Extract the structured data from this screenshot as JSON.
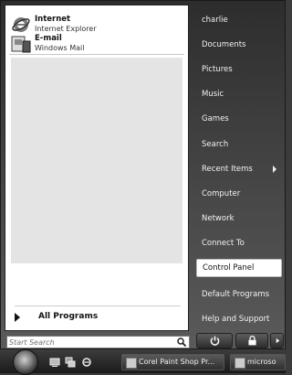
{
  "pinned": [
    {
      "title": "Internet",
      "subtitle": "Internet Explorer",
      "icon": "internet-explorer-icon"
    },
    {
      "title": "E-mail",
      "subtitle": "Windows Mail",
      "icon": "windows-mail-icon"
    }
  ],
  "all_programs": {
    "label": "All Programs"
  },
  "search": {
    "placeholder": "Start Search"
  },
  "right_pane": {
    "items": [
      {
        "label": "charlie"
      },
      {
        "label": "Documents"
      },
      {
        "label": "Pictures"
      },
      {
        "label": "Music"
      },
      {
        "label": "Games"
      },
      {
        "label": "Search"
      },
      {
        "label": "Recent Items",
        "has_submenu": true
      },
      {
        "label": "Computer"
      },
      {
        "label": "Network"
      },
      {
        "label": "Connect To"
      },
      {
        "label": "Control Panel",
        "highlighted": true
      },
      {
        "label": "Default Programs"
      },
      {
        "label": "Help and Support"
      }
    ]
  },
  "taskbar": {
    "start_icon": "windows-orb-icon",
    "tasks": [
      {
        "label": "Corel Paint Shop Pr..."
      },
      {
        "label": "microso"
      }
    ]
  }
}
